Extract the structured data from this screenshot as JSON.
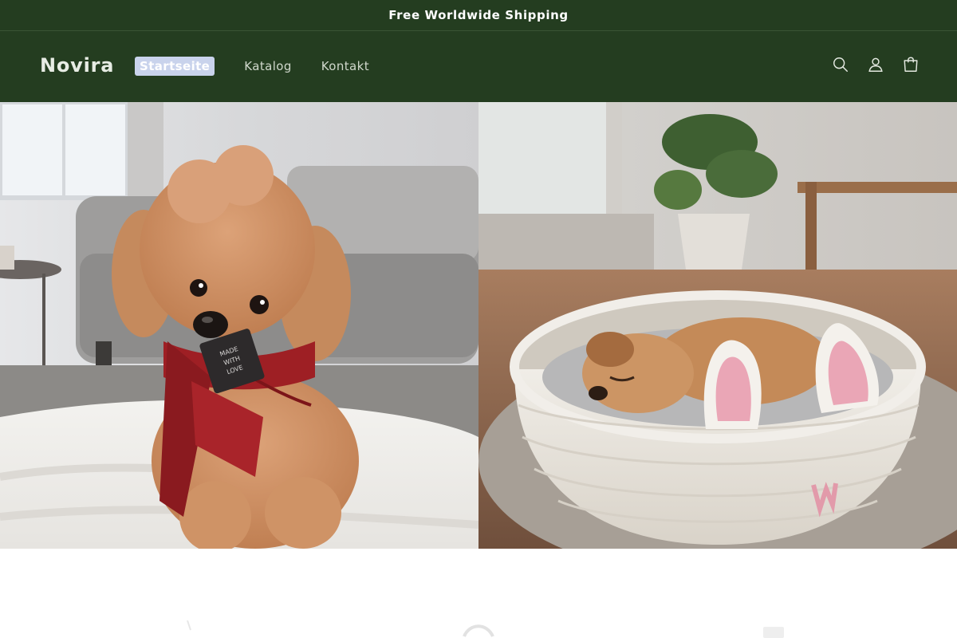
{
  "announcement": {
    "text": "Free Worldwide Shipping"
  },
  "header": {
    "logo": "Novira",
    "nav": [
      {
        "label": "Startseite",
        "active": true
      },
      {
        "label": "Katalog",
        "active": false
      },
      {
        "label": "Kontakt",
        "active": false
      }
    ],
    "icons": [
      "search-icon",
      "account-icon",
      "cart-icon"
    ]
  },
  "hero": {
    "images": [
      {
        "name": "poodle-with-red-knitted-scarf",
        "tag_text": "MADE WITH LOVE"
      },
      {
        "name": "puppy-sleeping-in-bunny-basket"
      }
    ]
  },
  "colors": {
    "header_bg": "#243d20",
    "active_pill": "#c9d3ec",
    "scarf": "#9e1f24",
    "basket": "#e9e4da",
    "bunny_ear_inner": "#eaa6b6"
  }
}
